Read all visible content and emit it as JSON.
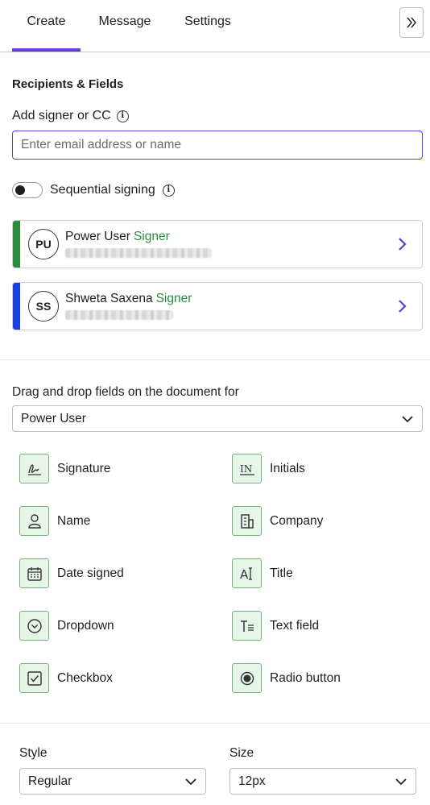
{
  "tabs": [
    {
      "label": "Create",
      "active": true
    },
    {
      "label": "Message",
      "active": false
    },
    {
      "label": "Settings",
      "active": false
    }
  ],
  "collapse_icon": "double-chevron-right-icon",
  "recipients_section": {
    "title": "Recipients & Fields",
    "add_label": "Add signer or CC",
    "email_placeholder": "Enter email address or name",
    "email_value": "",
    "sequential_label": "Sequential signing",
    "sequential_enabled": false
  },
  "recipients": [
    {
      "initials": "PU",
      "name": "Power User",
      "role": "Signer",
      "color": "#2b8a3e"
    },
    {
      "initials": "SS",
      "name": "Shweta Saxena",
      "role": "Signer",
      "color": "#1a3fe0"
    }
  ],
  "fields_section": {
    "label": "Drag and drop fields on the document for",
    "selected_recipient": "Power User",
    "fields": [
      {
        "label": "Signature",
        "icon": "signature-icon"
      },
      {
        "label": "Initials",
        "icon": "initials-icon"
      },
      {
        "label": "Name",
        "icon": "person-icon"
      },
      {
        "label": "Company",
        "icon": "building-icon"
      },
      {
        "label": "Date signed",
        "icon": "calendar-icon"
      },
      {
        "label": "Title",
        "icon": "title-text-icon"
      },
      {
        "label": "Dropdown",
        "icon": "dropdown-circle-icon"
      },
      {
        "label": "Text field",
        "icon": "text-field-icon"
      },
      {
        "label": "Checkbox",
        "icon": "checkbox-icon"
      },
      {
        "label": "Radio button",
        "icon": "radio-button-icon"
      }
    ]
  },
  "style_section": {
    "style_label": "Style",
    "style_value": "Regular",
    "size_label": "Size",
    "size_value": "12px"
  },
  "colors": {
    "accent": "#6a3fd4",
    "signer_green": "#2b8a3e",
    "field_icon_bg": "#e7f4e8",
    "field_icon_border": "#6fb579"
  }
}
